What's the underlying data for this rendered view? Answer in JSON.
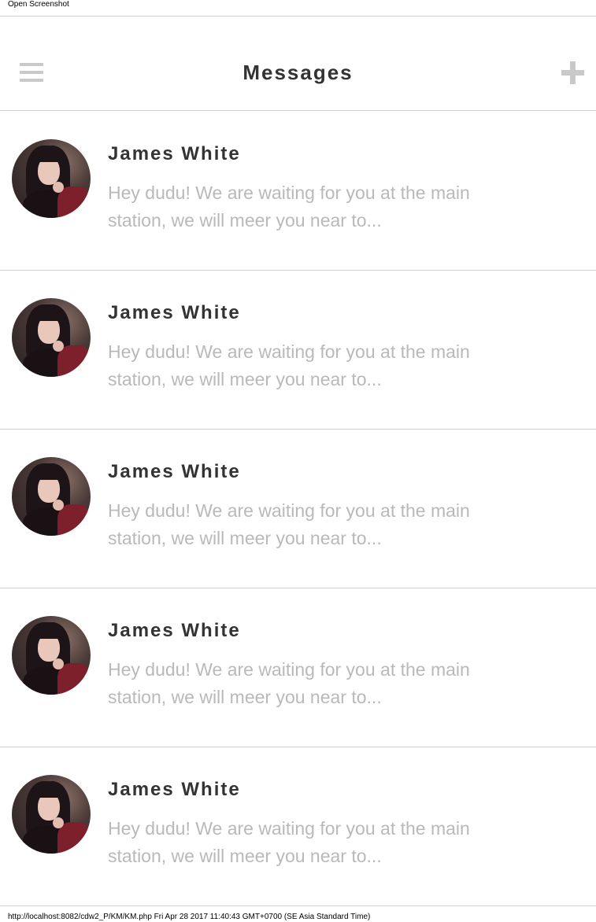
{
  "print_header": "Open Screenshot",
  "appbar": {
    "title": "Messages",
    "menu_icon": "hamburger-menu-icon",
    "add_icon": "plus-icon",
    "icon_color": "#c9c9c9"
  },
  "messages": [
    {
      "sender": "James White",
      "preview": "Hey dudu! We are waiting for you at the main station, we will meer you near to..."
    },
    {
      "sender": "James White",
      "preview": "Hey dudu! We are waiting for you at the main station, we will meer you near to..."
    },
    {
      "sender": "James White",
      "preview": "Hey dudu! We are waiting for you at the main station, we will meer you near to..."
    },
    {
      "sender": "James White",
      "preview": "Hey dudu! We are waiting for you at the main station, we will meer you near to..."
    },
    {
      "sender": "James White",
      "preview": "Hey dudu! We are waiting for you at the main station, we will meer you near to..."
    }
  ],
  "print_footer": "http://localhost:8082/cdw2_P/KM/KM.php Fri Apr 28 2017 11:40:43 GMT+0700 (SE Asia Standard Time)",
  "colors": {
    "title_text": "#333333",
    "preview_text": "#b9b9b9",
    "divider": "#cfcfcf"
  }
}
